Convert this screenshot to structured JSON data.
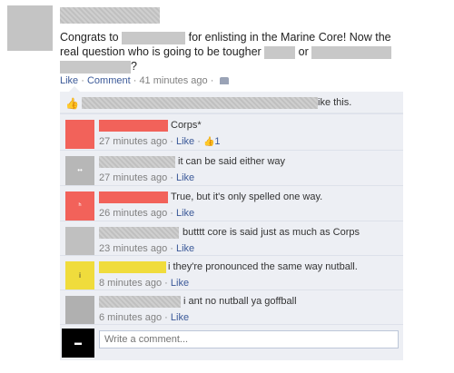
{
  "post": {
    "line1_pre": "Congrats to",
    "line1_post": "for enlisting in the Marine Core! Now the",
    "line2_pre": "real question who is going to be tougher",
    "line2_mid": "or",
    "line3_post": "?",
    "like_label": "Like",
    "sep": " · ",
    "comment_label": "Comment",
    "time": "41 minutes ago",
    "icon": "friends-icon"
  },
  "likes": {
    "icon": "thumbs-up-icon",
    "text": "ike this."
  },
  "comments": [
    {
      "text": "Corps*",
      "time": "27 minutes ago",
      "like": "Like",
      "like_count": "1",
      "avatar_color": "#f2625a",
      "avatar_glyph": ""
    },
    {
      "text": "it can be said either way",
      "time": "27 minutes ago",
      "like": "Like",
      "avatar_color": "#b7b7b7",
      "avatar_glyph": "••"
    },
    {
      "text": "True, but it's only spelled one way.",
      "time": "26 minutes ago",
      "like": "Like",
      "avatar_color": "#f2625a",
      "avatar_glyph": "ʰ"
    },
    {
      "text": "butttt core is said just as much as Corps",
      "time": "23 minutes ago",
      "like": "Like",
      "avatar_color": "#c0c0c0",
      "avatar_glyph": ""
    },
    {
      "text": "i they're pronounced the same way nutball.",
      "time": "8 minutes ago",
      "like": "Like",
      "avatar_color": "#f0dc3c",
      "avatar_glyph": "i"
    },
    {
      "text": "i ant no nutball ya goffball",
      "time": "6 minutes ago",
      "like": "Like",
      "avatar_color": "#b0b0b0",
      "avatar_glyph": ""
    }
  ],
  "write": {
    "placeholder": "Write a comment..."
  }
}
